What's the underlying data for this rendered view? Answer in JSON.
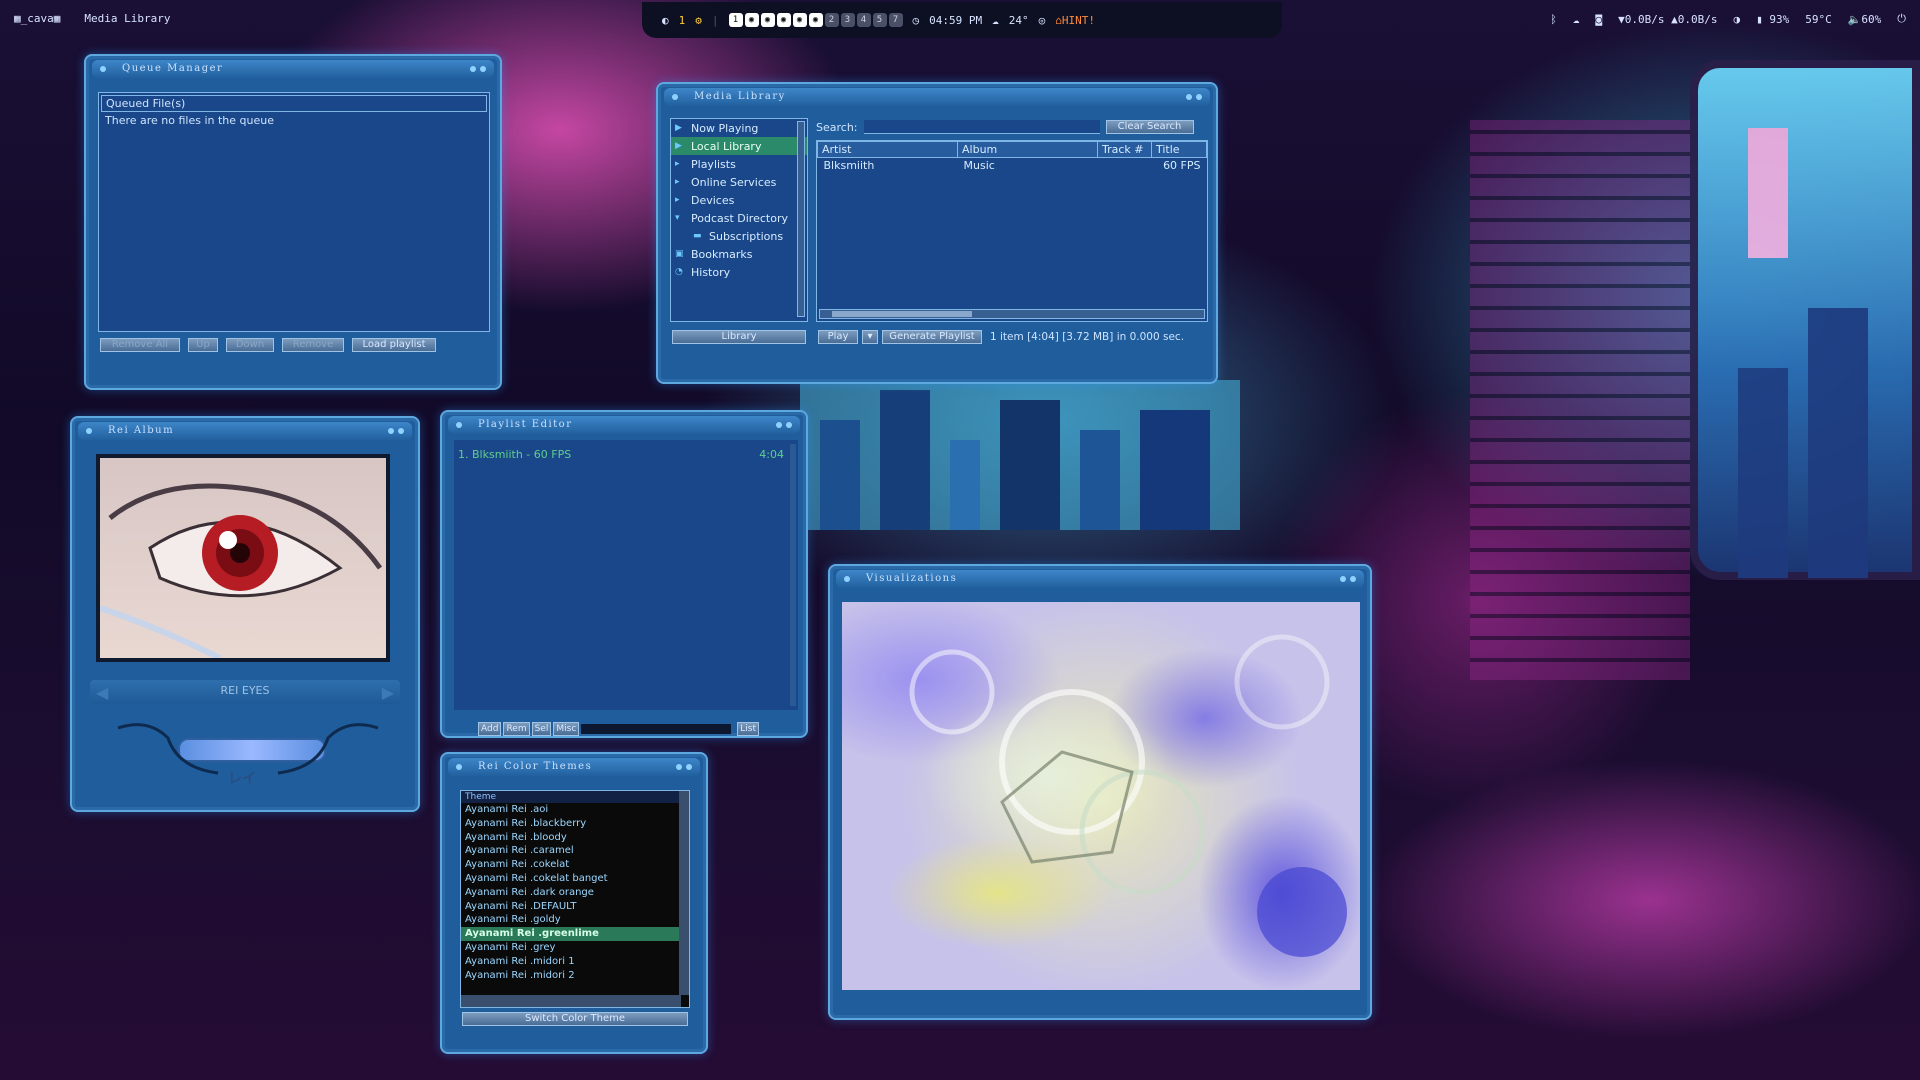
{
  "topbar": {
    "app_tag": "_cava",
    "window_title": "Media Library",
    "notif_count": "1",
    "workspaces": [
      "1",
      "2",
      "3",
      "4",
      "5",
      "6",
      "7"
    ],
    "clock": "04:59 PM",
    "weather": "24°",
    "hint": "HINT!",
    "net_down": "0.0B/s",
    "net_up": "0.0B/s",
    "brightness": "93%",
    "temp": "59°C",
    "volume": "60%"
  },
  "queue": {
    "title": "Queue Manager",
    "header": "Queued File(s)",
    "empty_msg": "There are no files in the queue",
    "buttons": [
      "Remove All",
      "Up",
      "Down",
      "Remove",
      "Load playlist"
    ]
  },
  "library": {
    "title": "Media Library",
    "tree": [
      {
        "label": "Now Playing",
        "icon": "play-icon"
      },
      {
        "label": "Local Library",
        "icon": "play-icon",
        "selected": true
      },
      {
        "label": "Playlists",
        "icon": "arrow-icon"
      },
      {
        "label": "Online Services",
        "icon": "arrow-icon"
      },
      {
        "label": "Devices",
        "icon": "arrow-icon"
      },
      {
        "label": "Podcast Directory",
        "icon": "down-arrow-icon"
      },
      {
        "label": "Subscriptions",
        "icon": "folder-icon",
        "indent": true
      },
      {
        "label": "Bookmarks",
        "icon": "bookmark-icon"
      },
      {
        "label": "History",
        "icon": "history-icon"
      }
    ],
    "search_label": "Search:",
    "search_value": "",
    "clear_button": "Clear Search",
    "columns": [
      "Artist",
      "Album",
      "Track #",
      "Title"
    ],
    "rows": [
      {
        "artist": "Blksmiith",
        "album": "Music",
        "track": "",
        "title": "60 FPS"
      }
    ],
    "library_button": "Library",
    "play_button": "Play",
    "generate_button": "Generate Playlist",
    "status": "1 item [4:04] [3.72 MB] in 0.000 sec."
  },
  "album": {
    "title": "Rei Album",
    "track_label": "REI EYES",
    "logo_text": "レイ"
  },
  "playlist": {
    "title": "Playlist Editor",
    "items": [
      {
        "label": "1. Blksmiith - 60 FPS",
        "time": "4:04"
      }
    ],
    "buttons": [
      "Add",
      "Rem",
      "Sel",
      "Misc",
      "List"
    ]
  },
  "themes": {
    "title": "Rei Color Themes",
    "header": "Theme",
    "items": [
      "Ayanami Rei .aoi",
      "Ayanami Rei .blackberry",
      "Ayanami Rei .bloody",
      "Ayanami Rei .caramel",
      "Ayanami Rei .cokelat",
      "Ayanami Rei .cokelat banget",
      "Ayanami Rei .dark orange",
      "Ayanami Rei .DEFAULT",
      "Ayanami Rei .goldy",
      "Ayanami Rei .greenlime",
      "Ayanami Rei .grey",
      "Ayanami Rei .midori 1",
      "Ayanami Rei .midori 2"
    ],
    "selected_index": 9,
    "switch_button": "Switch Color Theme"
  },
  "viz": {
    "title": "Visualizations"
  }
}
